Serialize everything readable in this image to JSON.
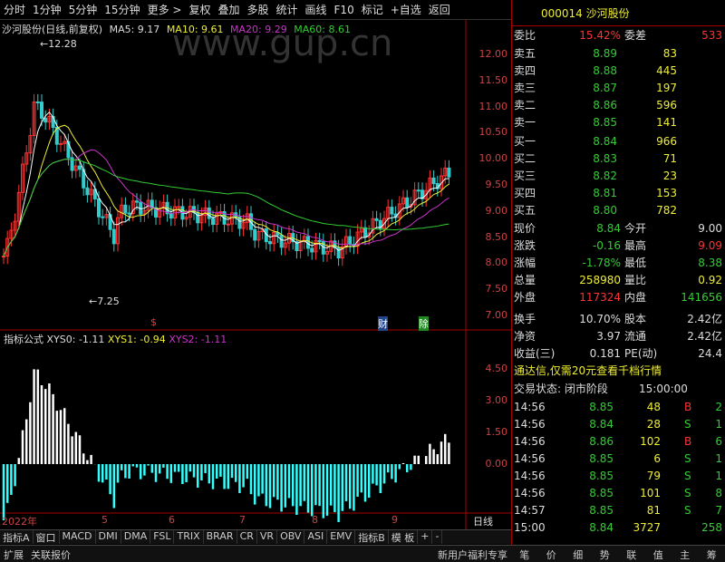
{
  "toolbar": {
    "items": [
      "分时",
      "1分钟",
      "5分钟",
      "15分钟",
      "更多 >",
      "复权",
      "叠加",
      "多股",
      "统计",
      "画线",
      "F10",
      "标记",
      "+自选",
      "返回"
    ]
  },
  "chart_title": {
    "name": "沙河股份(日线,前复权)",
    "ma5": "MA5: 9.17",
    "ma10": "MA10: 9.61",
    "ma20": "MA20: 9.29",
    "ma60": "MA60: 8.61"
  },
  "watermark": "www.gup.cn",
  "price_axis": [
    "12.00",
    "11.50",
    "11.00",
    "10.50",
    "10.00",
    "9.50",
    "9.00",
    "8.50",
    "8.00",
    "7.50",
    "7.00"
  ],
  "price_marks": {
    "high": "12.28",
    "low": "7.25"
  },
  "event_marks": [
    "$",
    "财",
    "除"
  ],
  "indicator_title": {
    "name": "指标公式",
    "xys0": "XYS0: -1.11",
    "xys1": "XYS1: -0.94",
    "xys2": "XYS2: -1.11"
  },
  "indicator_axis": [
    "4.50",
    "3.00",
    "1.50",
    "0.00"
  ],
  "date_axis": [
    "2022年",
    "5",
    "6",
    "7",
    "8",
    "9"
  ],
  "date_label": "日线",
  "tabs": [
    "指标A",
    "窗口",
    "MACD",
    "DMI",
    "DMA",
    "FSL",
    "TRIX",
    "BRAR",
    "CR",
    "VR",
    "OBV",
    "ASI",
    "EMV",
    "指标B",
    "模 板",
    "+",
    "-"
  ],
  "bottom": {
    "left": [
      "扩展",
      "关联报价"
    ],
    "promo": "新用户福利专享",
    "icons": [
      "笔",
      "价",
      "细",
      "势",
      "联",
      "值",
      "主",
      "筹"
    ]
  },
  "quote": {
    "code": "000014",
    "name": "沙河股份",
    "weibi_label": "委比",
    "weibi": "15.42%",
    "weicha_label": "委差",
    "weicha": "533",
    "asks": [
      {
        "label": "卖五",
        "price": "8.89",
        "vol": "83"
      },
      {
        "label": "卖四",
        "price": "8.88",
        "vol": "445"
      },
      {
        "label": "卖三",
        "price": "8.87",
        "vol": "197"
      },
      {
        "label": "卖二",
        "price": "8.86",
        "vol": "596"
      },
      {
        "label": "卖一",
        "price": "8.85",
        "vol": "141"
      }
    ],
    "bids": [
      {
        "label": "买一",
        "price": "8.84",
        "vol": "966"
      },
      {
        "label": "买二",
        "price": "8.83",
        "vol": "71"
      },
      {
        "label": "买三",
        "price": "8.82",
        "vol": "23"
      },
      {
        "label": "买四",
        "price": "8.81",
        "vol": "153"
      },
      {
        "label": "买五",
        "price": "8.80",
        "vol": "782"
      }
    ],
    "stats": [
      [
        "现价",
        "8.84",
        "今开",
        "9.00"
      ],
      [
        "涨跌",
        "-0.16",
        "最高",
        "9.09"
      ],
      [
        "涨幅",
        "-1.78%",
        "最低",
        "8.38"
      ],
      [
        "总量",
        "258980",
        "量比",
        "0.92"
      ],
      [
        "外盘",
        "117324",
        "内盘",
        "141656"
      ],
      [
        "换手",
        "10.70%",
        "股本",
        "2.42亿"
      ],
      [
        "净资",
        "3.97",
        "流通",
        "2.42亿"
      ],
      [
        "收益(三)",
        "0.181",
        "PE(动)",
        "24.4"
      ]
    ],
    "promo": "通达信,仅需20元查看千档行情",
    "status": "交易状态: 闭市阶段",
    "status_time": "15:00:00",
    "ticks": [
      [
        "14:56",
        "8.85",
        "48",
        "B",
        "2"
      ],
      [
        "14:56",
        "8.84",
        "28",
        "S",
        "1"
      ],
      [
        "14:56",
        "8.86",
        "102",
        "B",
        "6"
      ],
      [
        "14:56",
        "8.85",
        "6",
        "S",
        "1"
      ],
      [
        "14:56",
        "8.85",
        "79",
        "S",
        "1"
      ],
      [
        "14:56",
        "8.85",
        "101",
        "S",
        "8"
      ],
      [
        "14:57",
        "8.85",
        "81",
        "S",
        "7"
      ],
      [
        "15:00",
        "8.84",
        "3727",
        "",
        "258"
      ]
    ]
  }
}
